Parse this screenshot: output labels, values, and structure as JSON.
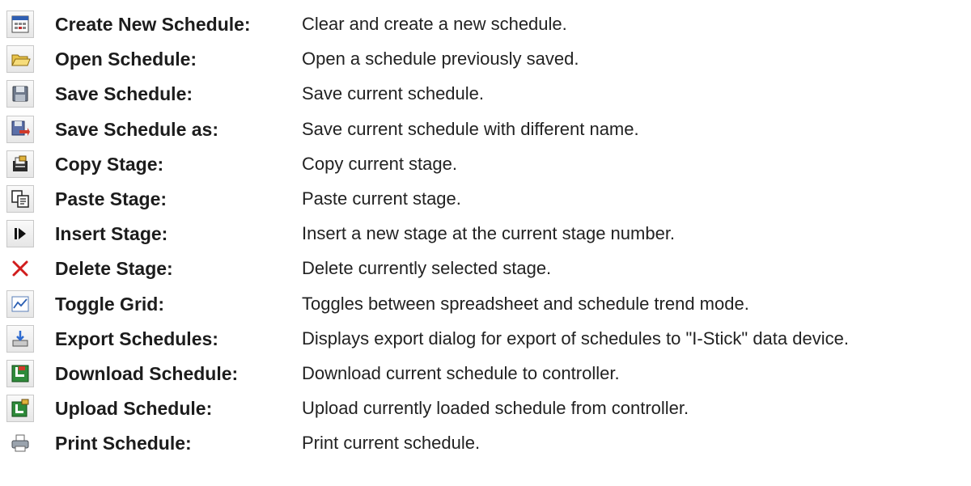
{
  "commands": [
    {
      "icon": "new-schedule-icon",
      "label": "Create New Schedule:",
      "description": "Clear and create a new schedule."
    },
    {
      "icon": "open-folder-icon",
      "label": "Open Schedule:",
      "description": "Open a schedule previously saved."
    },
    {
      "icon": "save-disk-icon",
      "label": "Save Schedule:",
      "description": "Save current schedule."
    },
    {
      "icon": "save-as-icon",
      "label": "Save Schedule as:",
      "description": "Save current schedule with different name."
    },
    {
      "icon": "copy-icon",
      "label": "Copy Stage:",
      "description": "Copy current stage."
    },
    {
      "icon": "paste-icon",
      "label": "Paste Stage:",
      "description": "Paste current stage."
    },
    {
      "icon": "insert-icon",
      "label": "Insert Stage:",
      "description": "Insert a new stage at the current stage number."
    },
    {
      "icon": "delete-x-icon",
      "label": "Delete Stage:",
      "description": "Delete currently selected stage."
    },
    {
      "icon": "toggle-grid-icon",
      "label": "Toggle Grid:",
      "description": "Toggles between spreadsheet and schedule trend mode."
    },
    {
      "icon": "export-icon",
      "label": "Export Schedules:",
      "description": "Displays export dialog for export of schedules to \"I-Stick\" data device."
    },
    {
      "icon": "download-icon",
      "label": "Download Schedule:",
      "description": "Download current schedule to controller."
    },
    {
      "icon": "upload-icon",
      "label": "Upload Schedule:",
      "description": "Upload currently loaded schedule from controller."
    },
    {
      "icon": "printer-icon",
      "label": "Print Schedule:",
      "description": "Print current schedule."
    }
  ]
}
